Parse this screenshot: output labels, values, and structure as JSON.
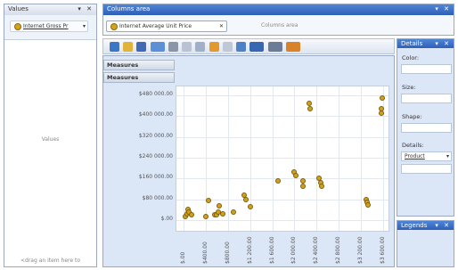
{
  "values_pane": {
    "title": "Values",
    "controls": "▾ ✕",
    "chip_label": "Internet Gross Pr",
    "chip_arrow": "▾",
    "center_label": "Values",
    "footer_hint": "<drag an item here to"
  },
  "columns_pane": {
    "title": "Columns area",
    "controls": "▾ ✕",
    "chip_label": "Internet Average Unit Price",
    "chip_close": "✕",
    "area_hint": "Columns area"
  },
  "chart_header": {
    "row1": "Measures",
    "row2": "Measures"
  },
  "details_pane": {
    "title": "Details",
    "controls": "▾ ✕",
    "color_label": "Color:",
    "size_label": "Size:",
    "shape_label": "Shape:",
    "details_label": "Details:",
    "details_value": "Product",
    "details_arrow": "▾"
  },
  "legends_pane": {
    "title": "Legends",
    "controls": "▾ ✕"
  },
  "toolbar_icons": [
    "grid-icon",
    "open-icon",
    "save-icon",
    "chart-type-icon",
    "print-icon",
    "preview-icon",
    "copy-icon",
    "undo-icon",
    "redo-icon",
    "table-icon",
    "chart-icon",
    "zoom-in-icon",
    "zoom-out-icon"
  ],
  "colors": {
    "accent": "#2f5fb8",
    "plot_bg": "#ffffff",
    "point_fill": "#d2a11c",
    "side_pane_bg": "#dbe6f6"
  },
  "chart_data": {
    "type": "scatter",
    "title": "",
    "xlabel": "",
    "ylabel": "",
    "y_ticks": [
      "$480 000.00",
      "$400 000.00",
      "$320 000.00",
      "$240 000.00",
      "$160 000.00",
      "$80 000.00",
      "$.00"
    ],
    "x_ticks": [
      "$.00",
      "$400.00",
      "$800.00",
      "$1 200.00",
      "$1 600.00",
      "$2 000.00",
      "$2 400.00",
      "$2 800.00",
      "$3 200.00",
      "$3 600.00"
    ],
    "xlim": [
      0,
      3600
    ],
    "ylim": [
      0,
      480000
    ],
    "grid": true,
    "points": [
      {
        "x": 40,
        "y": 15000
      },
      {
        "x": 60,
        "y": 25000
      },
      {
        "x": 80,
        "y": 40000
      },
      {
        "x": 100,
        "y": 30000
      },
      {
        "x": 150,
        "y": 20000
      },
      {
        "x": 400,
        "y": 15000
      },
      {
        "x": 450,
        "y": 75000
      },
      {
        "x": 560,
        "y": 20000
      },
      {
        "x": 600,
        "y": 22000
      },
      {
        "x": 620,
        "y": 30000
      },
      {
        "x": 650,
        "y": 55000
      },
      {
        "x": 700,
        "y": 25000
      },
      {
        "x": 900,
        "y": 30000
      },
      {
        "x": 1100,
        "y": 95000
      },
      {
        "x": 1120,
        "y": 80000
      },
      {
        "x": 1200,
        "y": 50000
      },
      {
        "x": 1700,
        "y": 150000
      },
      {
        "x": 2000,
        "y": 185000
      },
      {
        "x": 2020,
        "y": 170000
      },
      {
        "x": 2150,
        "y": 150000
      },
      {
        "x": 2160,
        "y": 130000
      },
      {
        "x": 2270,
        "y": 450000
      },
      {
        "x": 2290,
        "y": 430000
      },
      {
        "x": 2450,
        "y": 160000
      },
      {
        "x": 2470,
        "y": 145000
      },
      {
        "x": 2490,
        "y": 130000
      },
      {
        "x": 3300,
        "y": 80000
      },
      {
        "x": 3310,
        "y": 70000
      },
      {
        "x": 3320,
        "y": 60000
      },
      {
        "x": 3560,
        "y": 430000
      },
      {
        "x": 3570,
        "y": 410000
      },
      {
        "x": 3580,
        "y": 470000
      }
    ]
  }
}
